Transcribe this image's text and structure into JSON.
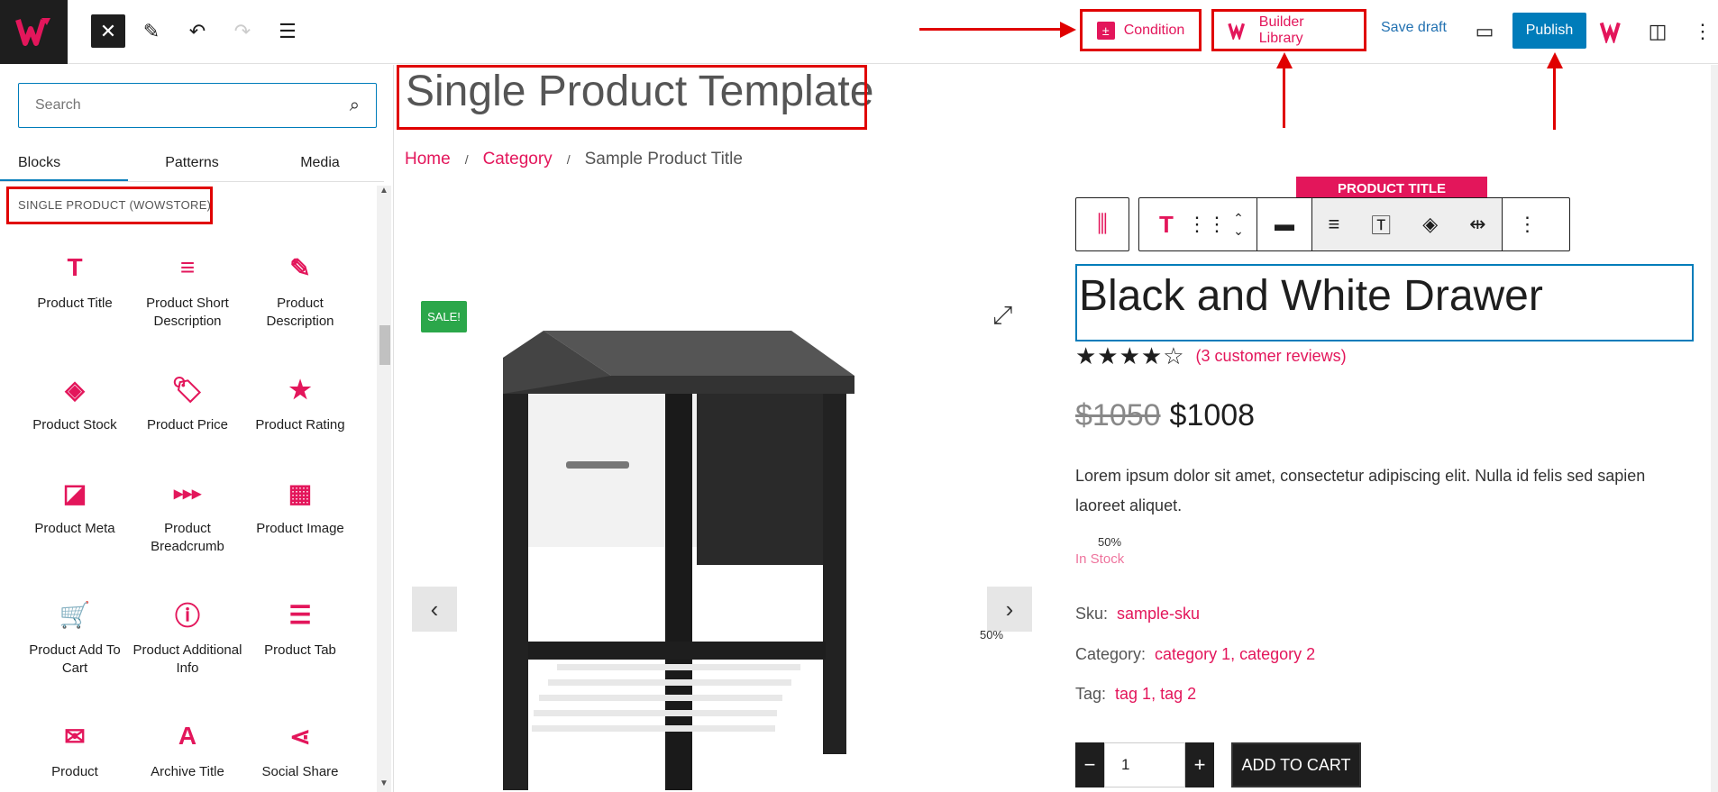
{
  "header": {
    "close_label": "✕",
    "condition_label": "Condition",
    "builder_library_label": "Builder Library",
    "save_draft_label": "Save draft",
    "publish_label": "Publish"
  },
  "sidebar": {
    "search_placeholder": "Search",
    "tabs": [
      "Blocks",
      "Patterns",
      "Media"
    ],
    "category_label": "SINGLE PRODUCT (WOWSTORE)",
    "blocks": [
      {
        "label": "Product Title",
        "icon": "T"
      },
      {
        "label": "Product Short Description",
        "icon": "≡"
      },
      {
        "label": "Product Description",
        "icon": "✎"
      },
      {
        "label": "Product Stock",
        "icon": "◈"
      },
      {
        "label": "Product Price",
        "icon": "🏷"
      },
      {
        "label": "Product Rating",
        "icon": "★"
      },
      {
        "label": "Product Meta",
        "icon": "◪"
      },
      {
        "label": "Product Breadcrumb",
        "icon": "▸▸▸"
      },
      {
        "label": "Product Image",
        "icon": "▦"
      },
      {
        "label": "Product Add To Cart",
        "icon": "🛒"
      },
      {
        "label": "Product Additional Info",
        "icon": "ⓘ"
      },
      {
        "label": "Product Tab",
        "icon": "☰"
      },
      {
        "label": "Product",
        "icon": "✉"
      },
      {
        "label": "Archive Title",
        "icon": "A"
      },
      {
        "label": "Social Share",
        "icon": "⋖"
      }
    ]
  },
  "editor": {
    "doc_title": "Single Product Template",
    "breadcrumb": [
      "Home",
      "Category",
      "Sample Product Title"
    ],
    "breadcrumb_sep": "/",
    "sale_badge": "SALE!",
    "percent_1": "50%",
    "percent_2": "50%",
    "toolbar_label": "PRODUCT TITLE",
    "product_title": "Black and White Drawer",
    "rating": 4,
    "reviews": "(3 customer reviews)",
    "old_price": "$1050",
    "price": "$1008",
    "description": "Lorem ipsum dolor sit amet, consectetur adipiscing elit. Nulla id felis sed sapien laoreet aliquet.",
    "stock": "In Stock",
    "sku_label": "Sku:",
    "sku_value": "sample-sku",
    "category_label": "Category:",
    "category_value": "category 1, category 2",
    "tag_label": "Tag:",
    "tag_value": "tag 1, tag 2",
    "qty": "1",
    "add_to_cart": "ADD TO CART"
  },
  "colors": {
    "brand_pink": "#e3165b",
    "publish_blue": "#007cba",
    "annotation_red": "#e00000",
    "sale_green": "#2ba74a"
  }
}
